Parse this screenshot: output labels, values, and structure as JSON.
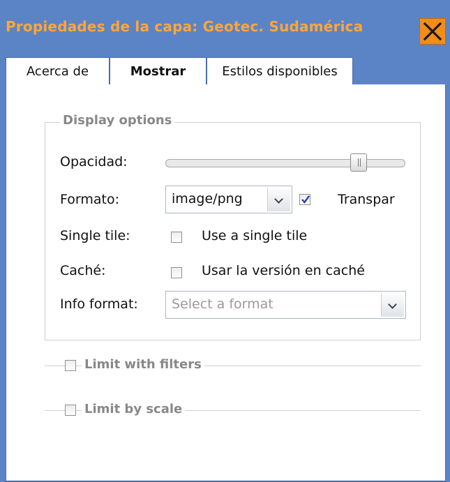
{
  "window": {
    "title": "Propiedades de la capa: Geotec. Sudamérica",
    "accent_color": "#5b84c6",
    "title_color": "#ffa63a",
    "close_icon": "close-icon"
  },
  "tabs": [
    {
      "label": "Acerca de",
      "active": false
    },
    {
      "label": "Mostrar",
      "active": true
    },
    {
      "label": "Estilos disponibles",
      "active": false
    }
  ],
  "display_options": {
    "legend": "Display options",
    "opacity": {
      "label": "Opacidad:",
      "value_fraction": 0.82
    },
    "format": {
      "label": "Formato:",
      "value": "image/png",
      "transparent_label": "Transpar",
      "transparent_checked": true
    },
    "single_tile": {
      "label": "Single tile:",
      "checkbox_label": "Use a single tile",
      "checked": false
    },
    "cache": {
      "label": "Caché:",
      "checkbox_label": "Usar la versión en caché",
      "checked": false
    },
    "info_format": {
      "label": "Info format:",
      "placeholder": "Select a format"
    }
  },
  "sections": {
    "filters_label": "Limit with filters",
    "scale_label": "Limit by scale"
  }
}
